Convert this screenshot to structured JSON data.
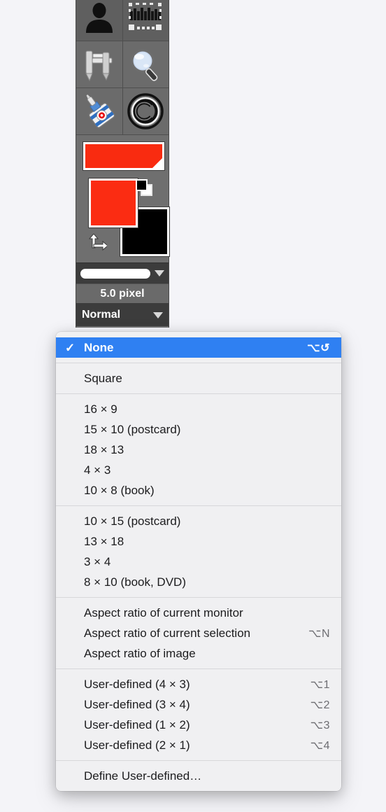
{
  "app": {
    "background_color": "#f4f4f8",
    "accent_color": "#2f80f2"
  },
  "toolbox": {
    "name": "GIMP Toolbox",
    "tools": [
      {
        "name": "foreground-select-tool",
        "icon": "person-silhouette-icon"
      },
      {
        "name": "warp-text-selection-tool",
        "icon": "selection-handles-icon"
      },
      {
        "name": "measure-tool",
        "icon": "caliper-icon"
      },
      {
        "name": "zoom-tool",
        "icon": "magnifier-icon"
      },
      {
        "name": "ink-tool",
        "icon": "ink-bottle-icon"
      },
      {
        "name": "copyright-tool",
        "icon": "copyright-circle-icon"
      }
    ],
    "gradient_swatch_color": "#fb2c12",
    "foreground_color": "#fb2c12",
    "background_color": "#000000",
    "brush_size": "5.0 pixel",
    "paint_mode": "Normal"
  },
  "menu": {
    "name": "aspect-ratio-menu",
    "groups": [
      {
        "items": [
          {
            "label": "None",
            "shortcut": "⌥↺",
            "checked": true,
            "selected": true
          }
        ]
      },
      {
        "items": [
          {
            "label": "Square",
            "shortcut": "",
            "checked": false,
            "selected": false
          }
        ]
      },
      {
        "items": [
          {
            "label": "16 × 9",
            "shortcut": "",
            "checked": false,
            "selected": false
          },
          {
            "label": "15 × 10 (postcard)",
            "shortcut": "",
            "checked": false,
            "selected": false
          },
          {
            "label": "18 × 13",
            "shortcut": "",
            "checked": false,
            "selected": false
          },
          {
            "label": "4 × 3",
            "shortcut": "",
            "checked": false,
            "selected": false
          },
          {
            "label": "10 × 8 (book)",
            "shortcut": "",
            "checked": false,
            "selected": false
          }
        ]
      },
      {
        "items": [
          {
            "label": "10 × 15 (postcard)",
            "shortcut": "",
            "checked": false,
            "selected": false
          },
          {
            "label": "13 × 18",
            "shortcut": "",
            "checked": false,
            "selected": false
          },
          {
            "label": "3 × 4",
            "shortcut": "",
            "checked": false,
            "selected": false
          },
          {
            "label": "8 × 10 (book, DVD)",
            "shortcut": "",
            "checked": false,
            "selected": false
          }
        ]
      },
      {
        "items": [
          {
            "label": "Aspect ratio of current monitor",
            "shortcut": "",
            "checked": false,
            "selected": false
          },
          {
            "label": "Aspect ratio of current selection",
            "shortcut": "⌥N",
            "checked": false,
            "selected": false
          },
          {
            "label": "Aspect ratio of image",
            "shortcut": "",
            "checked": false,
            "selected": false
          }
        ]
      },
      {
        "items": [
          {
            "label": "User-defined (4 × 3)",
            "shortcut": "⌥1",
            "checked": false,
            "selected": false
          },
          {
            "label": "User-defined (3 × 4)",
            "shortcut": "⌥2",
            "checked": false,
            "selected": false
          },
          {
            "label": "User-defined (1 × 2)",
            "shortcut": "⌥3",
            "checked": false,
            "selected": false
          },
          {
            "label": "User-defined (2 × 1)",
            "shortcut": "⌥4",
            "checked": false,
            "selected": false
          }
        ]
      },
      {
        "items": [
          {
            "label": "Define User-defined…",
            "shortcut": "",
            "checked": false,
            "selected": false
          }
        ]
      }
    ]
  }
}
